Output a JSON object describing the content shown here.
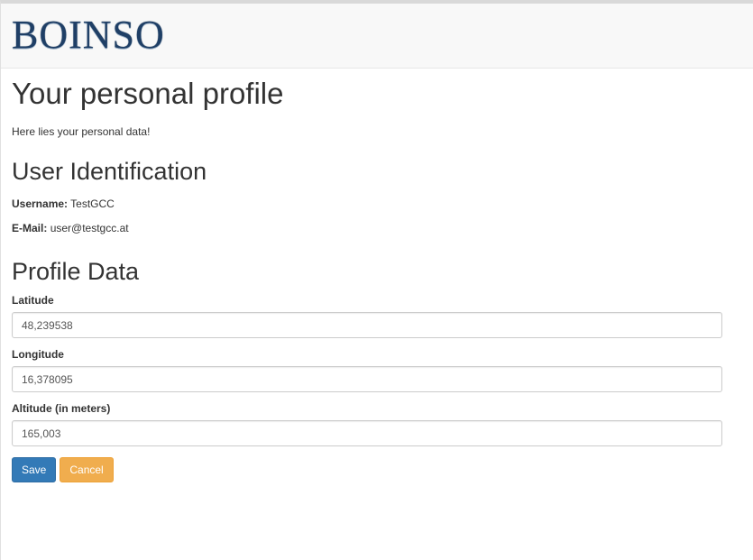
{
  "navbar": {
    "brand": "BOINSO"
  },
  "page": {
    "title": "Your personal profile",
    "subtitle": "Here lies your personal data!"
  },
  "identification": {
    "heading": "User Identification",
    "username_label": "Username:",
    "username_value": "TestGCC",
    "email_label": "E-Mail:",
    "email_value": "user@testgcc.at"
  },
  "profile": {
    "heading": "Profile Data",
    "latitude": {
      "label": "Latitude",
      "value": "48,239538"
    },
    "longitude": {
      "label": "Longitude",
      "value": "16,378095"
    },
    "altitude": {
      "label": "Altitude (in meters)",
      "value": "165,003"
    }
  },
  "actions": {
    "save_label": "Save",
    "cancel_label": "Cancel"
  },
  "colors": {
    "primary": "#337ab7",
    "warning": "#f0ad4e",
    "navbar_bg": "#f8f8f8"
  }
}
